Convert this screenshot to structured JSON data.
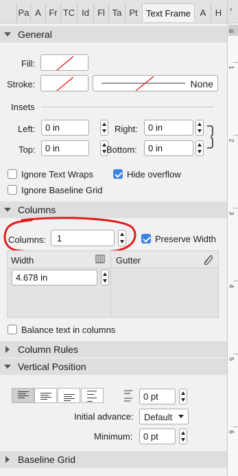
{
  "tabs": [
    "Pa",
    "A",
    "Fr",
    "TC",
    "Id",
    "Fl",
    "Ta",
    "Pt",
    "Text Frame",
    "A",
    "H"
  ],
  "sections": {
    "general": "General",
    "columns": "Columns",
    "column_rules": "Column Rules",
    "vertical_position": "Vertical Position",
    "baseline_grid": "Baseline Grid"
  },
  "general": {
    "fill_label": "Fill:",
    "stroke_label": "Stroke:",
    "stroke_style": "None",
    "insets_label": "Insets",
    "left_label": "Left:",
    "left_value": "0 in",
    "right_label": "Right:",
    "right_value": "0 in",
    "top_label": "Top:",
    "top_value": "0 in",
    "bottom_label": "Bottom:",
    "bottom_value": "0 in",
    "ignore_text_wraps": "Ignore Text Wraps",
    "hide_overflow": "Hide overflow",
    "ignore_baseline_grid": "Ignore Baseline Grid"
  },
  "columns": {
    "columns_label": "Columns:",
    "columns_value": "1",
    "preserve_width": "Preserve Width",
    "width_header": "Width",
    "gutter_header": "Gutter",
    "width_value": "4.678 in",
    "balance_text": "Balance text in columns"
  },
  "vertical": {
    "spacing_value": "0 pt",
    "initial_advance_label": "Initial advance:",
    "initial_advance_value": "Default",
    "minimum_label": "Minimum:",
    "minimum_value": "0 pt"
  },
  "ruler": {
    "numbers": [
      "1",
      "2",
      "3",
      "4",
      "5",
      "6"
    ],
    "top_text": "in"
  },
  "colors": {
    "accent": "#3b82e6",
    "annotation": "#e01b1b",
    "no_fill_line": "#e53935"
  }
}
